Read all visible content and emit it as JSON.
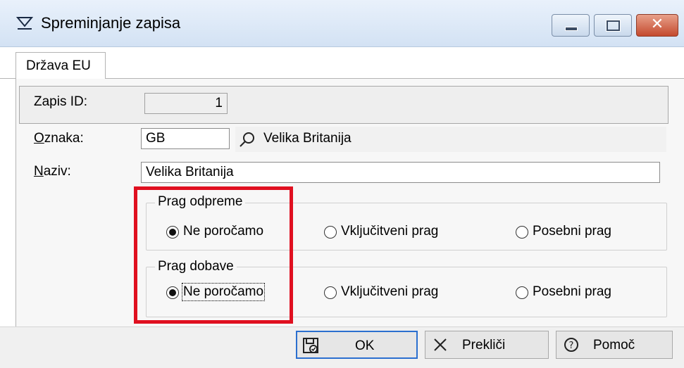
{
  "window": {
    "title": "Spreminjanje zapisa",
    "close_glyph": "✕"
  },
  "tabs": [
    {
      "label": "Država EU",
      "active": true
    }
  ],
  "form": {
    "zapis_id": {
      "label": "Zapis ID:",
      "value": "1"
    },
    "oznaka": {
      "label_first": "O",
      "label_rest": "znaka:",
      "value": "GB",
      "lookup_text": "Velika Britanija"
    },
    "naziv": {
      "label_first": "N",
      "label_rest": "aziv:",
      "value": "Velika Britanija"
    }
  },
  "groups": [
    {
      "legend": "Prag odpreme",
      "options": [
        {
          "label": "Ne poročamo",
          "checked": true
        },
        {
          "label": "Vključitveni prag",
          "checked": false
        },
        {
          "label": "Posebni prag",
          "checked": false
        }
      ]
    },
    {
      "legend": "Prag dobave",
      "options": [
        {
          "label": "Ne poročamo",
          "checked": true,
          "focused": true
        },
        {
          "label": "Vključitveni prag",
          "checked": false
        },
        {
          "label": "Posebni prag",
          "checked": false
        }
      ]
    }
  ],
  "buttons": {
    "ok": "OK",
    "cancel": "Prekliči",
    "help": "Pomoč"
  },
  "colors": {
    "highlight_box": "#e01020",
    "default_button_border": "#2b6fcf"
  },
  "icons": [
    "filter-icon",
    "minimize-icon",
    "maximize-icon",
    "close-icon",
    "search-icon",
    "save-icon",
    "cancel-x-icon",
    "help-icon"
  ]
}
